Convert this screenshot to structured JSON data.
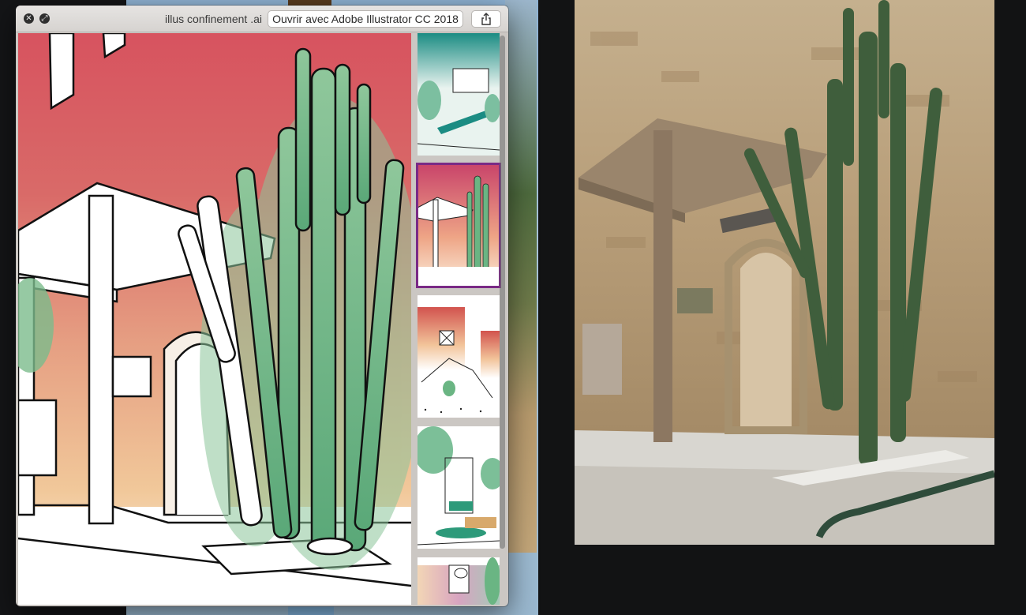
{
  "window": {
    "title": "illus confinement .ai",
    "open_button_label": "Ouvrir avec Adobe Illustrator CC 2018",
    "close_glyph": "✕",
    "fullscreen_glyph": "⤢",
    "share_icon": "share-icon"
  },
  "thumbnails": {
    "count": 5,
    "selected_index": 1
  },
  "colors": {
    "selection_outline": "#7a2a86",
    "sky_top": "#d7535f",
    "sky_bottom": "#f1c89a",
    "cactus_green": "#79b98e"
  }
}
